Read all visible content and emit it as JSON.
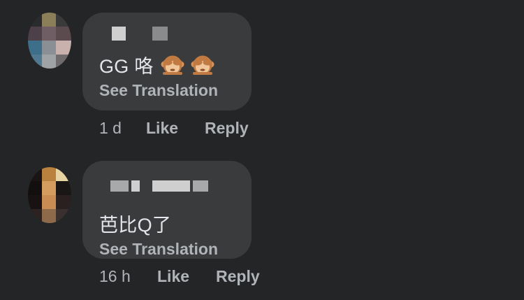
{
  "comments": [
    {
      "author_name": "",
      "text": "GG 咯",
      "emoji": [
        "see-no-evil-monkey",
        "see-no-evil-monkey"
      ],
      "see_translation": "See Translation",
      "time": "1 d",
      "like": "Like",
      "reply": "Reply"
    },
    {
      "author_name": "",
      "text": "芭比Q了",
      "emoji": [],
      "see_translation": "See Translation",
      "time": "16 h",
      "like": "Like",
      "reply": "Reply"
    }
  ],
  "colors": {
    "background": "#242526",
    "bubble": "#3a3b3c",
    "primary_text": "#e4e6eb",
    "secondary_text": "#b0b3b8"
  }
}
